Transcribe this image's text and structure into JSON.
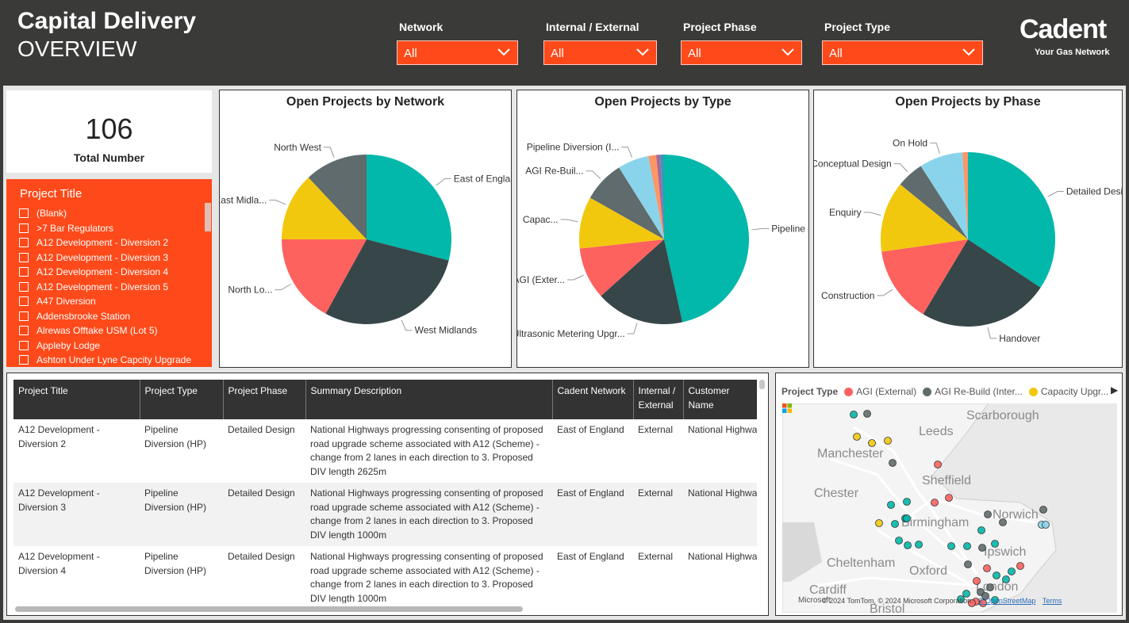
{
  "header": {
    "title_line1": "Capital Delivery",
    "title_line2": "OVERVIEW",
    "filters": [
      {
        "label": "Network",
        "value": "All"
      },
      {
        "label": "Internal / External",
        "value": "All"
      },
      {
        "label": "Project Phase",
        "value": "All"
      },
      {
        "label": "Project Type",
        "value": "All"
      }
    ],
    "logo": "Cadent",
    "logo_tagline": "Your Gas Network"
  },
  "kpi": {
    "value": "106",
    "label": "Total Number"
  },
  "slicer": {
    "title": "Project Title",
    "items": [
      "(Blank)",
      ">7 Bar Regulators",
      "A12 Development - Diversion 2",
      "A12 Development - Diversion 3",
      "A12 Development - Diversion 4",
      "A12 Development - Diversion 5",
      "A47 Diversion",
      "Addensbrooke Station",
      "Alrewas Offtake USM (Lot 5)",
      "Appleby Lodge",
      "Ashton Under Lyne Capcity Upgrade"
    ]
  },
  "chart_data": [
    {
      "type": "pie",
      "title": "Open Projects by Network",
      "series": [
        {
          "name": "",
          "values": [
            29,
            29,
            17,
            13,
            12
          ]
        }
      ],
      "categories": [
        "East of England",
        "West Midlands",
        "North Lo...",
        "East Midla...",
        "North West"
      ],
      "full_categories": [
        "East of England",
        "West Midlands",
        "North London",
        "East Midlands",
        "North West"
      ],
      "colors": [
        "#01b8aa",
        "#374649",
        "#fd625e",
        "#f2c80f",
        "#5f6b6d"
      ]
    },
    {
      "type": "pie",
      "title": "Open Projects by Type",
      "series": [
        {
          "name": "",
          "values": [
            47,
            17,
            10,
            10,
            8,
            6,
            1.5,
            0.8,
            0.7
          ]
        }
      ],
      "categories": [
        "Pipeline Dive...",
        "Ultrasonic Metering Upgr...",
        "AGI (Exter...",
        "Capac...",
        "AGI Re-Buil...",
        "Pipeline Diversion (I...",
        "",
        "",
        ""
      ],
      "colors": [
        "#01b8aa",
        "#374649",
        "#fd625e",
        "#f2c80f",
        "#5f6b6d",
        "#8ad4eb",
        "#fe9666",
        "#a66999",
        "#3599b8"
      ]
    },
    {
      "type": "pie",
      "title": "Open Projects by Phase",
      "series": [
        {
          "name": "",
          "values": [
            34,
            24,
            14,
            13,
            5,
            8,
            1
          ]
        }
      ],
      "categories": [
        "Detailed Design",
        "Handover",
        "Construction",
        "Enquiry",
        "Conceptual Design",
        "On Hold",
        ""
      ],
      "colors": [
        "#01b8aa",
        "#374649",
        "#fd625e",
        "#f2c80f",
        "#5f6b6d",
        "#8ad4eb",
        "#fe9666"
      ]
    }
  ],
  "table": {
    "columns": [
      "Project Title",
      "Project Type",
      "Project Phase",
      "Summary Description",
      "Cadent Network",
      "Internal / External",
      "Customer Name"
    ],
    "rows": [
      [
        "A12 Development - Diversion 2",
        "Pipeline Diversion (HP)",
        "Detailed Design",
        "National Highways progressing consenting of proposed road upgrade scheme associated with A12 (Scheme) - change from 2 lanes in each direction to 3. Proposed DIV length 2625m",
        "East of England",
        "External",
        "National Highways"
      ],
      [
        "A12 Development - Diversion 3",
        "Pipeline Diversion (HP)",
        "Detailed Design",
        "National Highways progressing consenting of proposed road upgrade scheme associated with A12 (Scheme) - change from 2 lanes in each direction to 3. Proposed DIV length 1000m",
        "East of England",
        "External",
        "National Highways"
      ],
      [
        "A12 Development - Diversion 4",
        "Pipeline Diversion (HP)",
        "Detailed Design",
        "National Highways progressing consenting of proposed road upgrade scheme associated with A12 (Scheme) - change from 2 lanes in each direction to 3. Proposed DIV length 1000m",
        "East of England",
        "External",
        "National Highways"
      ]
    ]
  },
  "map": {
    "legend_title": "Project Type",
    "legend_items": [
      {
        "label": "AGI (External)",
        "color": "#fd625e"
      },
      {
        "label": "AGI Re-Build (Inter...",
        "color": "#5f6b6d"
      },
      {
        "label": "Capacity Upgr...",
        "color": "#f2c80f"
      }
    ],
    "places": [
      "Scarborough",
      "Leeds",
      "Manchester",
      "Sheffield",
      "Chester",
      "Norwich",
      "Birmingham",
      "Ipswich",
      "Cheltenham",
      "Oxford",
      "London",
      "Cardiff",
      "Bristol"
    ],
    "microsoft_label": "Microsoft",
    "attribution": "© 2024 TomTom, © 2024 Microsoft Corporation",
    "osm_link": "© OpenStreetMap",
    "terms_link": "Terms",
    "legend_arrow_icon": "chevron-right-icon"
  }
}
